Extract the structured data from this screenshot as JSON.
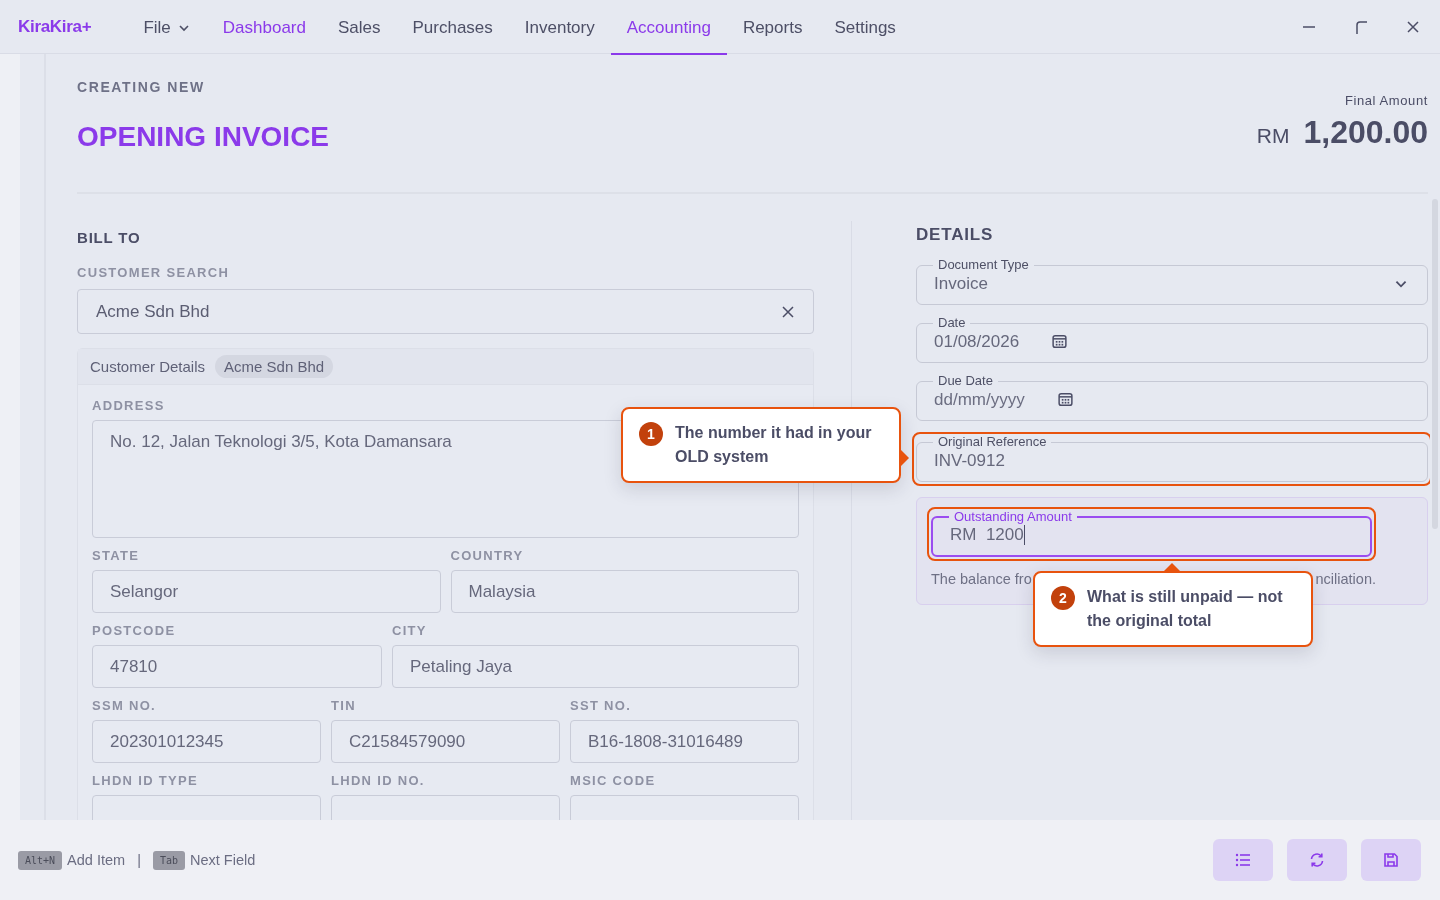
{
  "app": {
    "logo": "KiraKira+"
  },
  "menu": [
    {
      "label": "File",
      "kind": "dropdown",
      "selected": false
    },
    {
      "label": "Dashboard",
      "kind": "accent",
      "selected": false
    },
    {
      "label": "Sales",
      "kind": "plain",
      "selected": false
    },
    {
      "label": "Purchases",
      "kind": "plain",
      "selected": false
    },
    {
      "label": "Inventory",
      "kind": "plain",
      "selected": false
    },
    {
      "label": "Accounting",
      "kind": "plain",
      "selected": true
    },
    {
      "label": "Reports",
      "kind": "plain",
      "selected": false
    },
    {
      "label": "Settings",
      "kind": "plain",
      "selected": false
    }
  ],
  "header": {
    "eyebrow": "CREATING NEW",
    "title": "OPENING INVOICE",
    "total_label": "Final Amount",
    "currency": "RM",
    "total": "1,200.00"
  },
  "bill_to": {
    "heading": "BILL TO",
    "search_label": "CUSTOMER SEARCH",
    "search_value": "Acme Sdn Bhd",
    "details": {
      "title": "Customer Details",
      "badge": "Acme Sdn Bhd",
      "rows": [
        [
          {
            "label": "ADDRESS",
            "value": "No. 12, Jalan Teknologi 3/5, Kota Damansara",
            "kind": "textarea"
          }
        ],
        [
          {
            "label": "STATE",
            "value": "Selangor",
            "kind": "text"
          },
          {
            "label": "COUNTRY",
            "value": "Malaysia",
            "kind": "text"
          }
        ],
        [
          {
            "label": "POSTCODE",
            "value": "47810",
            "kind": "text"
          },
          {
            "label": "CITY",
            "value": "Petaling Jaya",
            "kind": "text"
          }
        ],
        [
          {
            "label": "SSM NO.",
            "value": "202301012345",
            "kind": "text"
          },
          {
            "label": "TIN",
            "value": "C21584579090",
            "kind": "text"
          },
          {
            "label": "SST NO.",
            "value": "B16-1808-31016489",
            "kind": "text"
          }
        ],
        [
          {
            "label": "LHDN ID TYPE",
            "kind": "text"
          },
          {
            "label": "LHDN ID NO.",
            "kind": "text"
          },
          {
            "label": "MSIC CODE",
            "kind": "text"
          }
        ]
      ]
    }
  },
  "details": {
    "heading": "DETAILS",
    "fields": [
      {
        "label": "Document Type",
        "value": "Invoice",
        "kind": "select",
        "highlighted": false
      },
      {
        "label": "Date",
        "value": "01/08/2026",
        "kind": "date",
        "highlighted": false
      },
      {
        "label": "Due Date",
        "placeholder": "dd/mm/yyyy",
        "kind": "date",
        "highlighted": false
      },
      {
        "label": "Original Reference",
        "value": "INV-0912",
        "kind": "text",
        "highlighted": true
      }
    ],
    "outstanding": {
      "label": "Outstanding Amount",
      "prefix": "RM",
      "value": "1200",
      "focused": true,
      "highlighted": true,
      "hint_start": "The balance fro",
      "hint_end": "nciliation."
    }
  },
  "callouts": [
    {
      "number": "1",
      "text": "The number it had in your OLD system"
    },
    {
      "number": "2",
      "text": "What is still unpaid — not the original total"
    }
  ],
  "footer": {
    "shortcuts": [
      {
        "key": "Alt+N",
        "label": "Add Item"
      },
      {
        "key": "Tab",
        "label": "Next Field"
      }
    ],
    "separator": "|"
  }
}
